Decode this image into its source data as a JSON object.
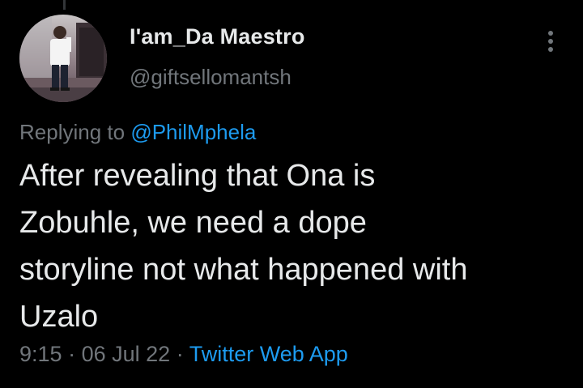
{
  "tweet": {
    "author": {
      "display_name": "I'am_Da Maestro",
      "handle": "@giftsellomantsh"
    },
    "replying_prefix": "Replying to ",
    "replying_to": "@PhilMphela",
    "text_lines": [
      "After revealing that Ona is",
      "Zobuhle, we need a dope",
      "storyline not what happened with",
      "Uzalo"
    ],
    "time": "9:15",
    "date": "06 Jul 22",
    "separator": "·",
    "source": "Twitter Web App"
  },
  "icons": {
    "more": "more-vertical-icon",
    "avatar": "profile-photo"
  },
  "colors": {
    "background": "#000000",
    "text_primary": "#e7e9ea",
    "text_secondary": "#71767b",
    "accent": "#1d9bf0"
  }
}
